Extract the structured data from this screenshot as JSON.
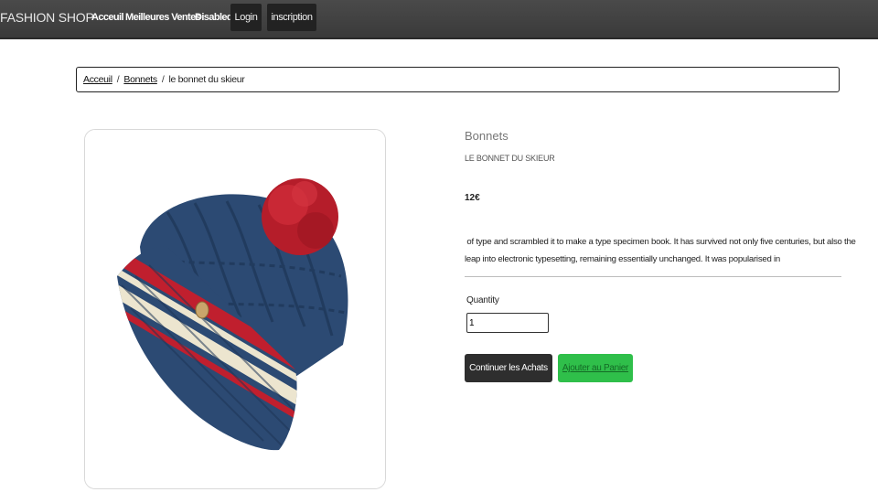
{
  "navbar": {
    "brand": "FASHION SHOP",
    "links": [
      "Acceuil",
      "Meilleures Ventes",
      "Disabled"
    ],
    "login_label": "Login",
    "register_label": "inscription"
  },
  "breadcrumb": {
    "home": "Acceuil",
    "category": "Bonnets",
    "current": "le bonnet du skieur"
  },
  "product": {
    "image_icon": "knitted-beanie-with-pompom",
    "category": "Bonnets",
    "name": "LE BONNET DU SKIEUR",
    "price": "12€",
    "description_line1": " of type and scrambled it to make a type specimen book. It has survived not only five centuries, but also the",
    "description_line2": "leap into electronic typesetting, remaining essentially unchanged. It was popularised in",
    "quantity_label": "Quantity",
    "quantity_value": "1"
  },
  "actions": {
    "continue_label": "Continuer les Achats",
    "add_to_cart_label": "Ajouter au Panier"
  },
  "colors": {
    "navbar": "#3f3f3f",
    "add_button": "#2fbf4a",
    "continue_button": "#2e2e2e",
    "hat_blue": "#2c4a73",
    "hat_red": "#c01f2e",
    "hat_cream": "#ece5cf"
  }
}
